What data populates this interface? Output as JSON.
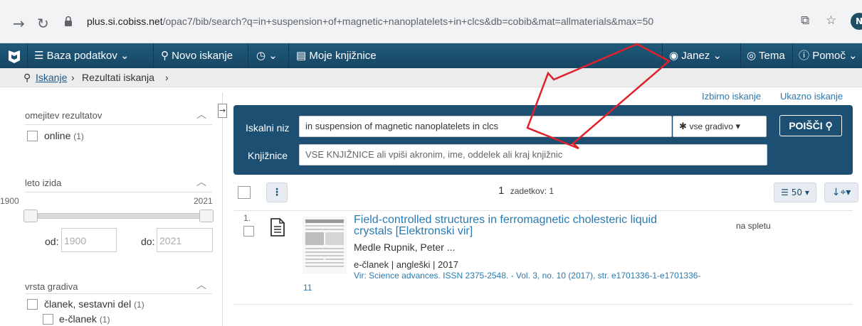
{
  "browser": {
    "url_host": "plus.si.cobiss.net",
    "url_path": "/opac7/bib/search?q=in+suspension+of+magnetic+nanoplatelets+in+clcs&db=cobib&mat=allmaterials&max=50",
    "profile_initial": "N"
  },
  "appbar": {
    "items": [
      {
        "label": "Baza podatkov"
      },
      {
        "label": "Novo iskanje"
      },
      {
        "label": ""
      },
      {
        "label": "Moje knjižnice"
      }
    ],
    "user": "Janez",
    "theme": "Tema",
    "help": "Pomoč"
  },
  "breadcrumb": {
    "search": "Iskanje",
    "results": "Rezultati iskanja"
  },
  "top_links": {
    "advanced": "Izbirno iskanje",
    "command": "Ukazno iskanje"
  },
  "sidebar": {
    "filter_title": "omejitev rezultatov",
    "online_label": "online",
    "online_count": "(1)",
    "year_title": "leto izida",
    "year_min": "1900",
    "year_max": "2021",
    "from_label": "od:",
    "from_value": "1900",
    "to_label": "do:",
    "to_value": "2021",
    "type_title": "vrsta gradiva",
    "type_items": [
      {
        "label": "članek, sestavni del",
        "count": "(1)"
      },
      {
        "label": "e-članek",
        "count": "(1)"
      }
    ]
  },
  "search": {
    "query_label": "Iskalni niz",
    "query_value": "in suspension of magnetic nanoplatelets in clcs",
    "material": "vse gradivo",
    "button": "POIŠČI",
    "libraries_label": "Knjižnice",
    "libraries_placeholder": "VSE KNJIŽNICE ali vpiši akronim, ime, oddelek ali kraj knjižnic"
  },
  "results": {
    "count_number": "1",
    "count_text": "zadetkov: 1",
    "per_page": "50",
    "items": [
      {
        "index": "1.",
        "title": "Field-controlled structures in ferromagnetic cholesteric liquid crystals [Elektronski vir]",
        "author": "Medle Rupnik, Peter ...",
        "meta": "e-članek | angleški | 2017",
        "source": "Vir: Science advances. ISSN 2375-2548. - Vol. 3, no. 10 (2017), str. e1701336-1-e1701336-11",
        "availability": "na spletu"
      }
    ]
  },
  "colors": {
    "navbar": "#1b4f72",
    "search_panel": "#1c4f71",
    "link": "#2a7ab0",
    "annotation_arrow": "#e0202a"
  }
}
